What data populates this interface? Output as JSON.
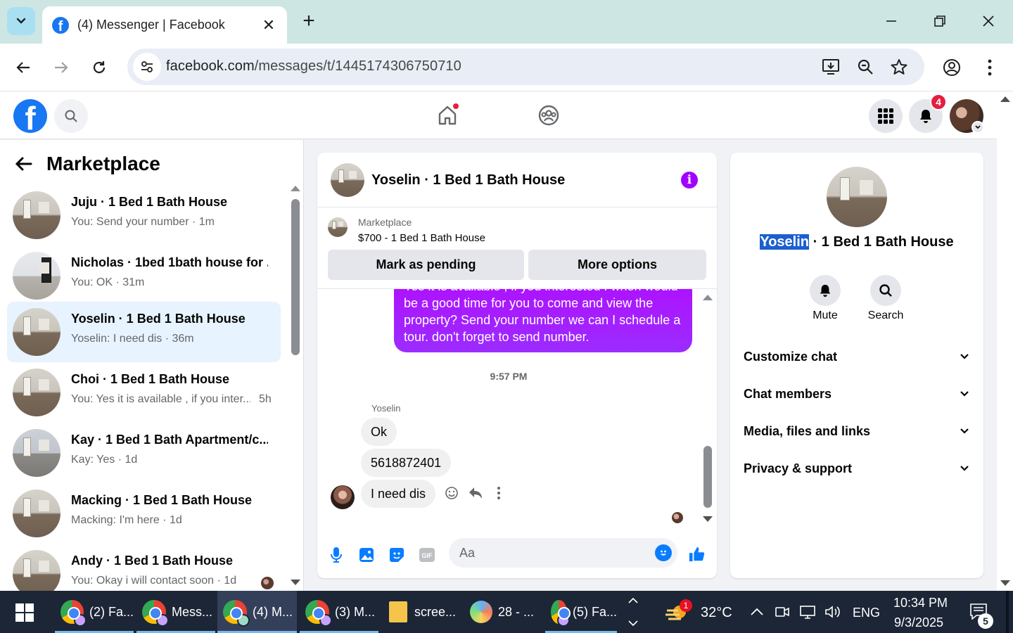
{
  "browser": {
    "tab_title": "(4) Messenger | Facebook",
    "url_host": "facebook.com",
    "url_path": "/messages/t/1445174306750710"
  },
  "sidebar": {
    "title": "Marketplace",
    "conversations": [
      {
        "name": "Juju · 1 Bed 1 Bath House",
        "preview": "You: Send your number · 1m",
        "time": ""
      },
      {
        "name": "Nicholas · 1bed 1bath house for ...",
        "preview": "You: OK · 31m",
        "time": ""
      },
      {
        "name": "Yoselin · 1 Bed 1 Bath House",
        "preview": "Yoselin: I need dis · 36m",
        "time": ""
      },
      {
        "name": "Choi · 1 Bed 1 Bath House",
        "preview": "You: Yes it is available , if you inter...",
        "time": "5h"
      },
      {
        "name": "Kay · 1 Bed 1 Bath Apartment/c...",
        "preview": "Kay: Yes · 1d",
        "time": ""
      },
      {
        "name": "Macking · 1 Bed 1 Bath House",
        "preview": "Macking: I'm here · 1d",
        "time": ""
      },
      {
        "name": "Andy · 1 Bed 1 Bath House",
        "preview": "You: Okay i will contact soon · 1d",
        "time": ""
      }
    ]
  },
  "chat": {
    "title": "Yoselin · 1 Bed 1 Bath House",
    "listing_source": "Marketplace",
    "listing_title": "$700 - 1 Bed 1 Bath House",
    "mark_pending_label": "Mark as pending",
    "more_options_label": "More options",
    "outgoing_message": "Yes it is available , if you interested . when would be  a good time for you to come and view the property? Send your number we can I schedule  a tour. don't forget to send  number.",
    "timestamp": "9:57 PM",
    "sender_name": "Yoselin",
    "incoming": [
      "Ok",
      "5618872401",
      "I need dis"
    ],
    "composer_placeholder": "Aa"
  },
  "info_panel": {
    "title_highlight": "Yoselin",
    "title_rest": " · 1 Bed 1 Bath House",
    "mute_label": "Mute",
    "search_label": "Search",
    "sections": [
      "Customize chat",
      "Chat members",
      "Media, files and links",
      "Privacy & support"
    ]
  },
  "fb_header": {
    "notification_count": "4"
  },
  "taskbar": {
    "items": [
      "(2) Fa...",
      "Mess...",
      "(4) M...",
      "(3) M...",
      "scree...",
      "28 - ...",
      "(5) Fa..."
    ],
    "weather_badge": "1",
    "temperature": "32°C",
    "language": "ENG",
    "time": "10:34 PM",
    "date": "9/3/2025",
    "notification_count": "5"
  },
  "colors": {
    "fb_blue": "#1877f2",
    "messenger_purple": "#a100ff",
    "selected_conversation_bg": "#e7f3ff",
    "notification_red": "#e41e3f"
  }
}
